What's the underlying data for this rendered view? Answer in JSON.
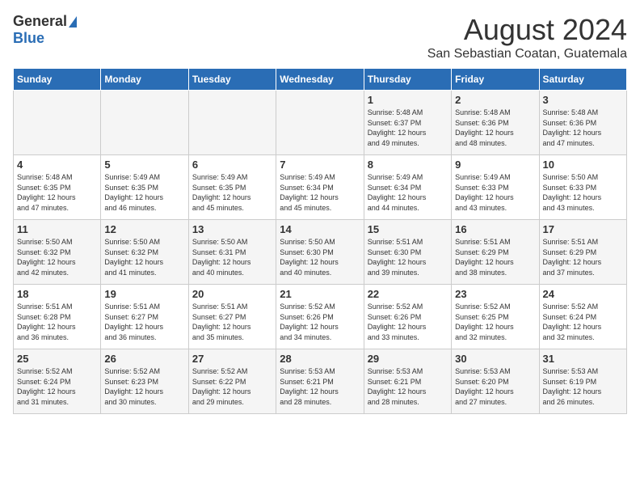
{
  "header": {
    "logo_general": "General",
    "logo_blue": "Blue",
    "month_title": "August 2024",
    "location": "San Sebastian Coatan, Guatemala"
  },
  "days_of_week": [
    "Sunday",
    "Monday",
    "Tuesday",
    "Wednesday",
    "Thursday",
    "Friday",
    "Saturday"
  ],
  "weeks": [
    [
      {
        "day": "",
        "detail": ""
      },
      {
        "day": "",
        "detail": ""
      },
      {
        "day": "",
        "detail": ""
      },
      {
        "day": "",
        "detail": ""
      },
      {
        "day": "1",
        "detail": "Sunrise: 5:48 AM\nSunset: 6:37 PM\nDaylight: 12 hours\nand 49 minutes."
      },
      {
        "day": "2",
        "detail": "Sunrise: 5:48 AM\nSunset: 6:36 PM\nDaylight: 12 hours\nand 48 minutes."
      },
      {
        "day": "3",
        "detail": "Sunrise: 5:48 AM\nSunset: 6:36 PM\nDaylight: 12 hours\nand 47 minutes."
      }
    ],
    [
      {
        "day": "4",
        "detail": "Sunrise: 5:48 AM\nSunset: 6:35 PM\nDaylight: 12 hours\nand 47 minutes."
      },
      {
        "day": "5",
        "detail": "Sunrise: 5:49 AM\nSunset: 6:35 PM\nDaylight: 12 hours\nand 46 minutes."
      },
      {
        "day": "6",
        "detail": "Sunrise: 5:49 AM\nSunset: 6:35 PM\nDaylight: 12 hours\nand 45 minutes."
      },
      {
        "day": "7",
        "detail": "Sunrise: 5:49 AM\nSunset: 6:34 PM\nDaylight: 12 hours\nand 45 minutes."
      },
      {
        "day": "8",
        "detail": "Sunrise: 5:49 AM\nSunset: 6:34 PM\nDaylight: 12 hours\nand 44 minutes."
      },
      {
        "day": "9",
        "detail": "Sunrise: 5:49 AM\nSunset: 6:33 PM\nDaylight: 12 hours\nand 43 minutes."
      },
      {
        "day": "10",
        "detail": "Sunrise: 5:50 AM\nSunset: 6:33 PM\nDaylight: 12 hours\nand 43 minutes."
      }
    ],
    [
      {
        "day": "11",
        "detail": "Sunrise: 5:50 AM\nSunset: 6:32 PM\nDaylight: 12 hours\nand 42 minutes."
      },
      {
        "day": "12",
        "detail": "Sunrise: 5:50 AM\nSunset: 6:32 PM\nDaylight: 12 hours\nand 41 minutes."
      },
      {
        "day": "13",
        "detail": "Sunrise: 5:50 AM\nSunset: 6:31 PM\nDaylight: 12 hours\nand 40 minutes."
      },
      {
        "day": "14",
        "detail": "Sunrise: 5:50 AM\nSunset: 6:30 PM\nDaylight: 12 hours\nand 40 minutes."
      },
      {
        "day": "15",
        "detail": "Sunrise: 5:51 AM\nSunset: 6:30 PM\nDaylight: 12 hours\nand 39 minutes."
      },
      {
        "day": "16",
        "detail": "Sunrise: 5:51 AM\nSunset: 6:29 PM\nDaylight: 12 hours\nand 38 minutes."
      },
      {
        "day": "17",
        "detail": "Sunrise: 5:51 AM\nSunset: 6:29 PM\nDaylight: 12 hours\nand 37 minutes."
      }
    ],
    [
      {
        "day": "18",
        "detail": "Sunrise: 5:51 AM\nSunset: 6:28 PM\nDaylight: 12 hours\nand 36 minutes."
      },
      {
        "day": "19",
        "detail": "Sunrise: 5:51 AM\nSunset: 6:27 PM\nDaylight: 12 hours\nand 36 minutes."
      },
      {
        "day": "20",
        "detail": "Sunrise: 5:51 AM\nSunset: 6:27 PM\nDaylight: 12 hours\nand 35 minutes."
      },
      {
        "day": "21",
        "detail": "Sunrise: 5:52 AM\nSunset: 6:26 PM\nDaylight: 12 hours\nand 34 minutes."
      },
      {
        "day": "22",
        "detail": "Sunrise: 5:52 AM\nSunset: 6:26 PM\nDaylight: 12 hours\nand 33 minutes."
      },
      {
        "day": "23",
        "detail": "Sunrise: 5:52 AM\nSunset: 6:25 PM\nDaylight: 12 hours\nand 32 minutes."
      },
      {
        "day": "24",
        "detail": "Sunrise: 5:52 AM\nSunset: 6:24 PM\nDaylight: 12 hours\nand 32 minutes."
      }
    ],
    [
      {
        "day": "25",
        "detail": "Sunrise: 5:52 AM\nSunset: 6:24 PM\nDaylight: 12 hours\nand 31 minutes."
      },
      {
        "day": "26",
        "detail": "Sunrise: 5:52 AM\nSunset: 6:23 PM\nDaylight: 12 hours\nand 30 minutes."
      },
      {
        "day": "27",
        "detail": "Sunrise: 5:52 AM\nSunset: 6:22 PM\nDaylight: 12 hours\nand 29 minutes."
      },
      {
        "day": "28",
        "detail": "Sunrise: 5:53 AM\nSunset: 6:21 PM\nDaylight: 12 hours\nand 28 minutes."
      },
      {
        "day": "29",
        "detail": "Sunrise: 5:53 AM\nSunset: 6:21 PM\nDaylight: 12 hours\nand 28 minutes."
      },
      {
        "day": "30",
        "detail": "Sunrise: 5:53 AM\nSunset: 6:20 PM\nDaylight: 12 hours\nand 27 minutes."
      },
      {
        "day": "31",
        "detail": "Sunrise: 5:53 AM\nSunset: 6:19 PM\nDaylight: 12 hours\nand 26 minutes."
      }
    ]
  ]
}
